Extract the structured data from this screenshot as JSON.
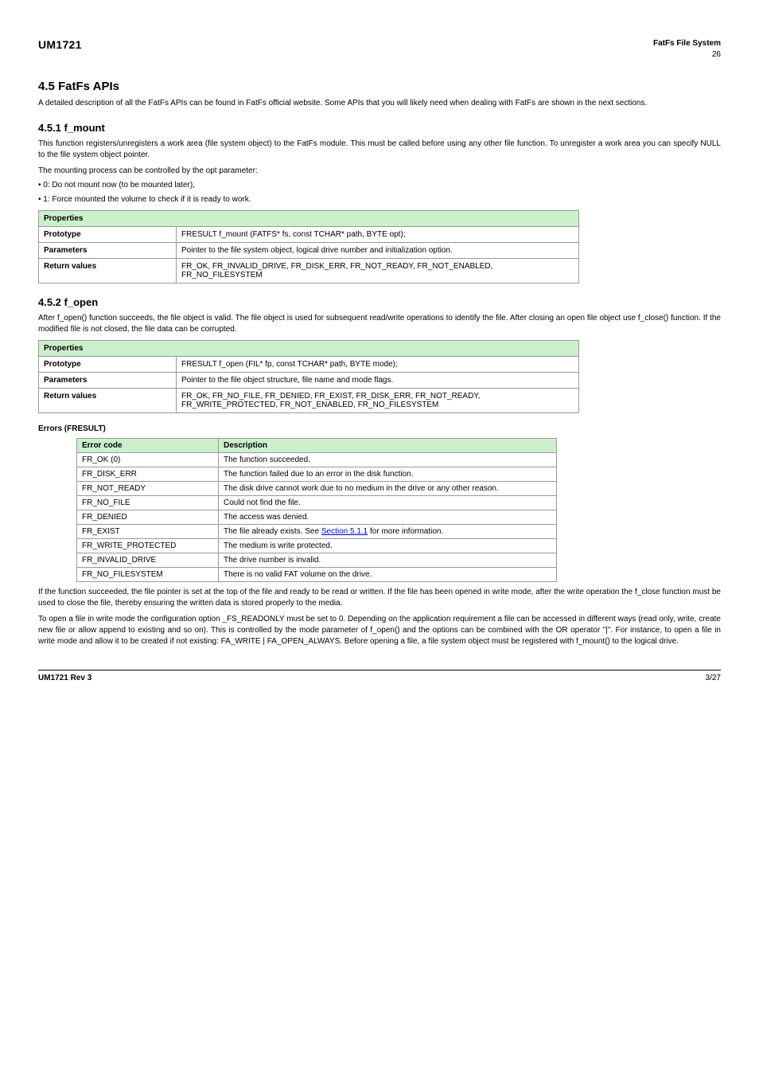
{
  "header": {
    "left_title": "UM1721",
    "right_lib": "FatFs File System",
    "right_version": "26"
  },
  "sections": {
    "s45": {
      "title": "4.5 FatFs APIs",
      "para1": "A detailed description of all the FatFs APIs can be found in FatFs official website. Some APIs that you will likely need when dealing with FatFs are shown in the next sections."
    },
    "s451": {
      "title": "4.5.1 f_mount",
      "para1": "This function registers/unregisters a work area (file system object) to the FatFs module. This must be called before using any other file function. To unregister a work area you can specify NULL to the file system object pointer.",
      "enum_intro": "The mounting process can be controlled by the opt parameter:",
      "enum1": "• 0: Do not mount now (to be mounted later),",
      "enum2": "• 1: Force mounted the volume to check if it is ready to work."
    },
    "t1": {
      "caption": "Properties",
      "rows": [
        {
          "k": "Prototype",
          "v": "FRESULT f_mount (FATFS* fs, const TCHAR* path, BYTE opt);"
        },
        {
          "k": "Parameters",
          "v": "Pointer to the file system object, logical drive number and initialization option."
        },
        {
          "k": "Return values",
          "v": "FR_OK, FR_INVALID_DRIVE, FR_DISK_ERR, FR_NOT_READY, FR_NOT_ENABLED, FR_NO_FILESYSTEM"
        }
      ]
    },
    "s452": {
      "title": "4.5.2 f_open",
      "para1": "After f_open() function succeeds, the file object is valid. The file object is used for subsequent read/write operations to identify the file. After closing an open file object use f_close() function. If the modified file is not closed, the file data can be corrupted."
    },
    "t2": {
      "caption": "Properties",
      "rows": [
        {
          "k": "Prototype",
          "v": "FRESULT f_open (FIL* fp, const TCHAR* path, BYTE mode);"
        },
        {
          "k": "Parameters",
          "v": "Pointer to the file object structure, file name and mode flags."
        },
        {
          "k": "Return values",
          "v": "FR_OK, FR_NO_FILE, FR_DENIED, FR_EXIST, FR_DISK_ERR, FR_NOT_READY, FR_WRITE_PROTECTED, FR_NOT_ENABLED, FR_NO_FILESYSTEM"
        }
      ]
    },
    "errors_label": "Errors (FRESULT)",
    "errors": {
      "cols": [
        "Error code",
        "Description"
      ],
      "rows": [
        {
          "k": "FR_OK (0)",
          "v": "The function succeeded."
        },
        {
          "k": "FR_DISK_ERR",
          "v": "The function failed due to an error in the disk function."
        },
        {
          "k": "FR_NOT_READY",
          "v": "The disk drive cannot work due to no medium in the drive or any other reason."
        },
        {
          "k": "FR_NO_FILE",
          "v": "Could not find the file."
        },
        {
          "k": "FR_DENIED",
          "v": "The access was denied."
        },
        {
          "k": "FR_EXIST",
          "v": "The file already exists.",
          "link_label": "Section 5.1.1",
          "link_suffix": " for more information."
        },
        {
          "k": "FR_WRITE_PROTECTED",
          "v": "The medium is write protected."
        },
        {
          "k": "FR_INVALID_DRIVE",
          "v": "The drive number is invalid."
        },
        {
          "k": "FR_NO_FILESYSTEM",
          "v": "There is no valid FAT volume on the drive."
        }
      ]
    }
  },
  "para_after_errors": {
    "p1": "If the function succeeded, the file pointer is set at the top of the file and ready to be read or written. If the file has been opened in write mode, after the write operation the f_close function must be used to close the file, thereby ensuring the written data is stored properly to the media.",
    "p2": "To open a file in write mode the configuration option _FS_READONLY must be set to 0. Depending on the application requirement a file can be accessed in different ways (read only, write, create new file or allow append to existing and so on). This is controlled by the mode parameter of f_open() and the options can be combined with the OR operator \"|\". For instance, to open a file in write mode and allow it to be created if not existing: FA_WRITE | FA_OPEN_ALWAYS. Before opening a file, a file system object must be registered with f_mount() to the logical drive."
  },
  "footer": {
    "left": "UM1721 Rev 3",
    "right": "3/27"
  }
}
